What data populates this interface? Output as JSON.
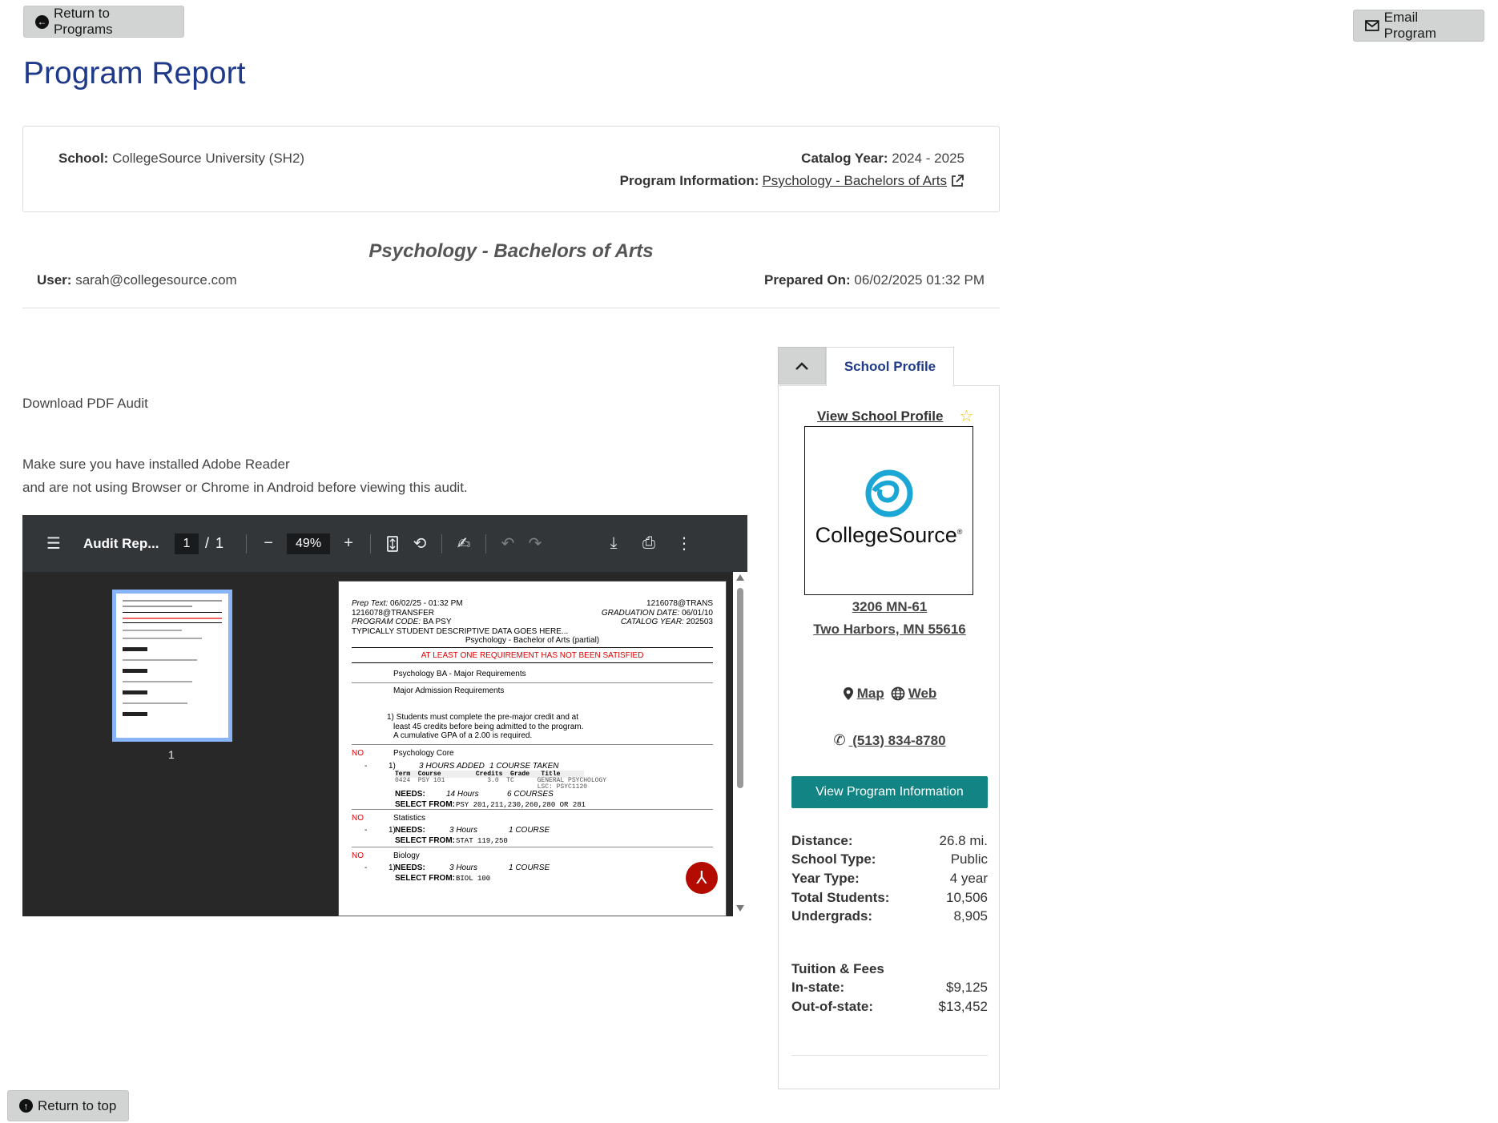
{
  "header": {
    "return_programs_label": "Return to Programs",
    "email_program_label": "Email Program",
    "page_title": "Program Report"
  },
  "info_card": {
    "school_label": "School:",
    "school_value": "CollegeSource University (SH2)",
    "catalog_year_label": "Catalog Year:",
    "catalog_year_value": "2024 - 2025",
    "program_info_label": "Program Information:",
    "program_info_link": "Psychology - Bachelors of Arts"
  },
  "report": {
    "title": "Psychology - Bachelors of Arts",
    "user_label": "User:",
    "user_value": "sarah@collegesource.com",
    "prepared_label": "Prepared On:",
    "prepared_value": "06/02/2025 01:32 PM",
    "download_text": "Download PDF Audit",
    "note_line1": "Make sure you have installed Adobe Reader",
    "note_line2": "and are not using Browser or Chrome in Android before viewing this audit."
  },
  "pdf_viewer": {
    "doc_title": "Audit Rep...",
    "page_current": "1",
    "page_sep": "/",
    "page_total": "1",
    "zoom": "49%",
    "thumb_label": "1",
    "page": {
      "prep_text_label": "Prep Text:",
      "prep_text_value": "06/02/25 - 01:32 PM",
      "id_right": "1216078@TRANS",
      "id_left": "1216078@TRANSFER",
      "grad_label": "GRADUATION DATE:",
      "grad_value": "06/01/10",
      "program_code_label": "PROGRAM CODE:",
      "program_code_value": "BA PSY",
      "catalog_label": "CATALOG YEAR:",
      "catalog_value": "202503",
      "descriptive": "TYPICALLY STUDENT DESCRIPTIVE DATA GOES HERE...",
      "program_name": "Psychology - Bachelor of Arts (partial)",
      "warning": "AT LEAST ONE REQUIREMENT HAS NOT BEEN SATISFIED",
      "major_req": "Psychology BA - Major Requirements",
      "admission_req": "Major Admission Requirements",
      "admission_1": "1) Students must complete the pre-major credit and at",
      "admission_2": "least 45 credits before being admitted to the program.",
      "admission_3": "A cumulative GPA of a 2.00 is required.",
      "no_label": "NO",
      "dash": "-",
      "core_title": "Psychology Core",
      "core_num": "1)",
      "core_hours_added": "3 HOURS ADDED",
      "core_course_taken": "1 COURSE TAKEN",
      "table_header": "Term  Course         Credits  Grade   Title",
      "table_row1": "0424  PSY 101           3.0  TC      GENERAL PSYCHOLOGY",
      "table_row2": "                                     LSC: PSYC1120",
      "needs_label": "NEEDS:",
      "core_needs_hours": "14 Hours",
      "core_needs_courses": "6 COURSES",
      "select_label": "SELECT FROM:",
      "core_select": "PSY  201,211,230,260,280 OR 281",
      "stats_title": "Statistics",
      "stats_num": "1)",
      "stats_hours": "3 Hours",
      "stats_course": "1 COURSE",
      "stats_select": "STAT 119,250",
      "bio_title": "Biology",
      "bio_num": "1)",
      "bio_hours": "3 Hours",
      "bio_course": "1 COURSE",
      "bio_select": "BIOL 100"
    }
  },
  "school_panel": {
    "tab_label": "School Profile",
    "view_profile_link": "View School Profile",
    "logo_text": "CollegeSource",
    "logo_mark": "®",
    "address_line1": "3206 MN-61",
    "address_line2": "Two Harbors, MN 55616",
    "map_link": "Map",
    "web_link": "Web",
    "phone": " (513) 834-8780",
    "view_program_button": "View Program Information",
    "stats": [
      {
        "label": "Distance:",
        "value": "26.8 mi."
      },
      {
        "label": "School Type:",
        "value": "Public"
      },
      {
        "label": "Year Type:",
        "value": "4 year"
      },
      {
        "label": "Total Students:",
        "value": "10,506"
      },
      {
        "label": "Undergrads:",
        "value": "8,905"
      }
    ],
    "tuition_heading": "Tuition & Fees",
    "tuition": [
      {
        "label": "In-state:",
        "value": "$9,125"
      },
      {
        "label": "Out-of-state:",
        "value": "$13,452"
      }
    ]
  },
  "footer": {
    "return_top_label": "Return to top"
  },
  "colors": {
    "title_blue": "#1f3a8a",
    "teal": "#128484",
    "pdf_toolbar": "#323639",
    "logo_cyan": "#1aa7d6",
    "star_yellow": "#f0c419"
  }
}
